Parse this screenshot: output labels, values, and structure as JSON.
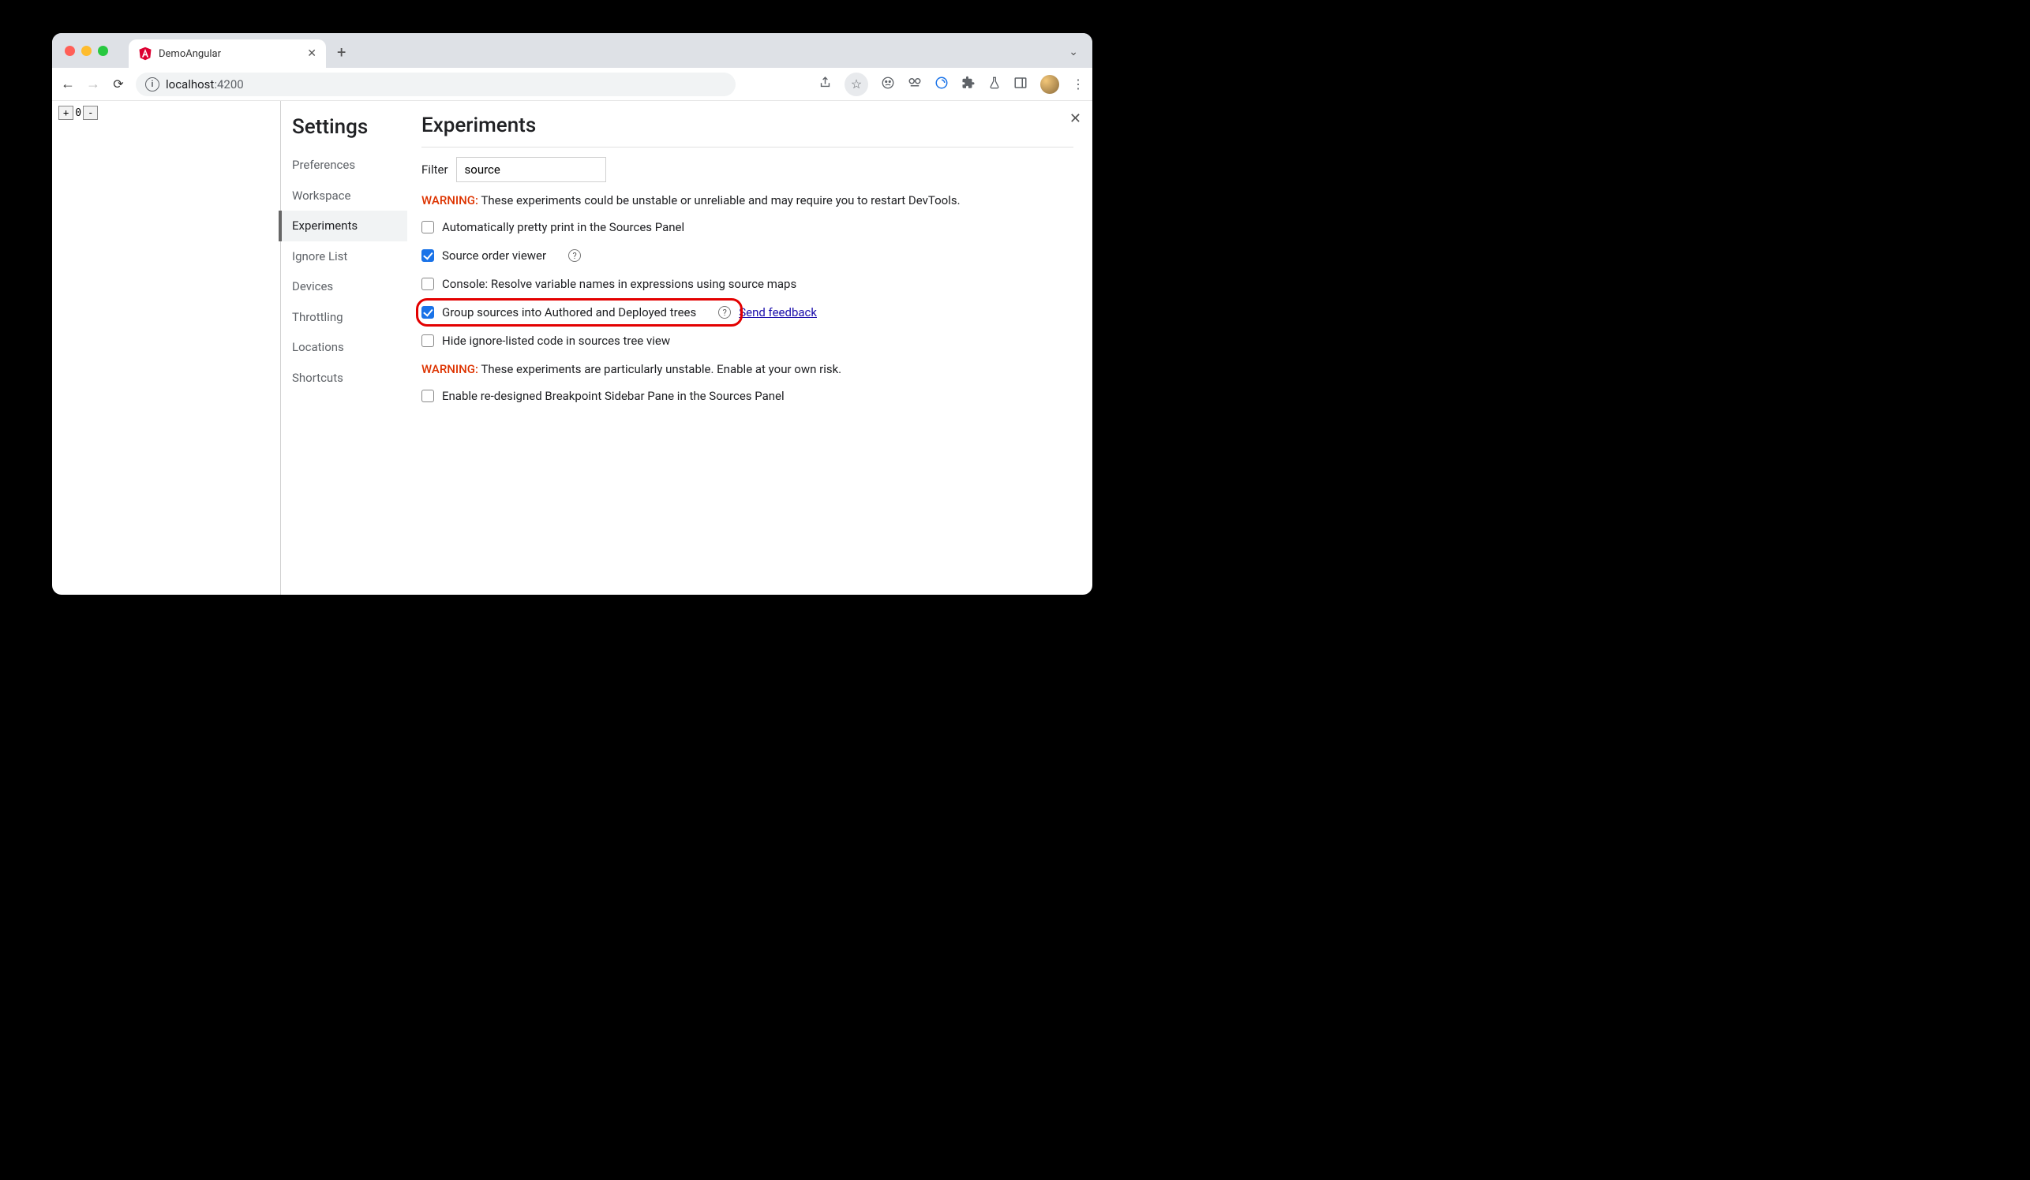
{
  "tab": {
    "title": "DemoAngular"
  },
  "address": {
    "host": "localhost",
    "port": ":4200"
  },
  "page_left": {
    "btn_plus": "+",
    "value": "0",
    "btn_minus": "-"
  },
  "settings": {
    "title": "Settings",
    "nav": {
      "preferences": "Preferences",
      "workspace": "Workspace",
      "experiments": "Experiments",
      "ignore_list": "Ignore List",
      "devices": "Devices",
      "throttling": "Throttling",
      "locations": "Locations",
      "shortcuts": "Shortcuts"
    }
  },
  "panel": {
    "title": "Experiments",
    "filter_label": "Filter",
    "filter_value": "source",
    "warning1_prefix": "WARNING:",
    "warning1_text": " These experiments could be unstable or unreliable and may require you to restart DevTools.",
    "warning2_prefix": "WARNING:",
    "warning2_text": " These experiments are particularly unstable. Enable at your own risk.",
    "feedback": "Send feedback",
    "experiments": {
      "auto_pretty": "Automatically pretty print in the Sources Panel",
      "source_order": "Source order viewer",
      "console_resolve": "Console: Resolve variable names in expressions using source maps",
      "group_sources": "Group sources into Authored and Deployed trees",
      "hide_ignore": "Hide ignore-listed code in sources tree view",
      "breakpoint_sidebar": "Enable re-designed Breakpoint Sidebar Pane in the Sources Panel"
    }
  }
}
